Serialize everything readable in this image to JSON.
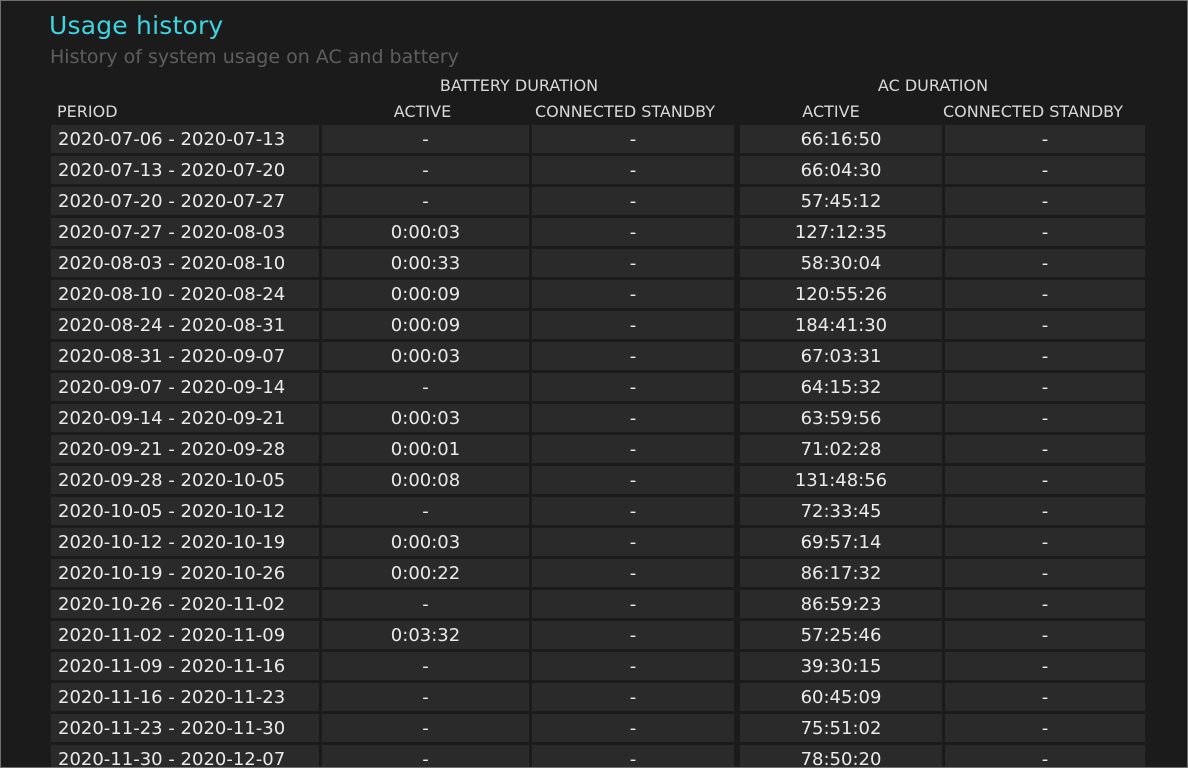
{
  "header": {
    "title": "Usage history",
    "subtitle": "History of system usage on AC and battery"
  },
  "table": {
    "group_headers": {
      "battery": "BATTERY DURATION",
      "ac": "AC DURATION"
    },
    "columns": {
      "period": "PERIOD",
      "battery_active": "ACTIVE",
      "battery_connected_standby": "CONNECTED STANDBY",
      "ac_active": "ACTIVE",
      "ac_connected_standby": "CONNECTED STANDBY"
    },
    "rows": [
      {
        "period": "2020-07-06 - 2020-07-13",
        "battery_active": "-",
        "battery_cs": "-",
        "ac_active": "66:16:50",
        "ac_cs": "-"
      },
      {
        "period": "2020-07-13 - 2020-07-20",
        "battery_active": "-",
        "battery_cs": "-",
        "ac_active": "66:04:30",
        "ac_cs": "-"
      },
      {
        "period": "2020-07-20 - 2020-07-27",
        "battery_active": "-",
        "battery_cs": "-",
        "ac_active": "57:45:12",
        "ac_cs": "-"
      },
      {
        "period": "2020-07-27 - 2020-08-03",
        "battery_active": "0:00:03",
        "battery_cs": "-",
        "ac_active": "127:12:35",
        "ac_cs": "-"
      },
      {
        "period": "2020-08-03 - 2020-08-10",
        "battery_active": "0:00:33",
        "battery_cs": "-",
        "ac_active": "58:30:04",
        "ac_cs": "-"
      },
      {
        "period": "2020-08-10 - 2020-08-24",
        "battery_active": "0:00:09",
        "battery_cs": "-",
        "ac_active": "120:55:26",
        "ac_cs": "-"
      },
      {
        "period": "2020-08-24 - 2020-08-31",
        "battery_active": "0:00:09",
        "battery_cs": "-",
        "ac_active": "184:41:30",
        "ac_cs": "-"
      },
      {
        "period": "2020-08-31 - 2020-09-07",
        "battery_active": "0:00:03",
        "battery_cs": "-",
        "ac_active": "67:03:31",
        "ac_cs": "-"
      },
      {
        "period": "2020-09-07 - 2020-09-14",
        "battery_active": "-",
        "battery_cs": "-",
        "ac_active": "64:15:32",
        "ac_cs": "-"
      },
      {
        "period": "2020-09-14 - 2020-09-21",
        "battery_active": "0:00:03",
        "battery_cs": "-",
        "ac_active": "63:59:56",
        "ac_cs": "-"
      },
      {
        "period": "2020-09-21 - 2020-09-28",
        "battery_active": "0:00:01",
        "battery_cs": "-",
        "ac_active": "71:02:28",
        "ac_cs": "-"
      },
      {
        "period": "2020-09-28 - 2020-10-05",
        "battery_active": "0:00:08",
        "battery_cs": "-",
        "ac_active": "131:48:56",
        "ac_cs": "-"
      },
      {
        "period": "2020-10-05 - 2020-10-12",
        "battery_active": "-",
        "battery_cs": "-",
        "ac_active": "72:33:45",
        "ac_cs": "-"
      },
      {
        "period": "2020-10-12 - 2020-10-19",
        "battery_active": "0:00:03",
        "battery_cs": "-",
        "ac_active": "69:57:14",
        "ac_cs": "-"
      },
      {
        "period": "2020-10-19 - 2020-10-26",
        "battery_active": "0:00:22",
        "battery_cs": "-",
        "ac_active": "86:17:32",
        "ac_cs": "-"
      },
      {
        "period": "2020-10-26 - 2020-11-02",
        "battery_active": "-",
        "battery_cs": "-",
        "ac_active": "86:59:23",
        "ac_cs": "-"
      },
      {
        "period": "2020-11-02 - 2020-11-09",
        "battery_active": "0:03:32",
        "battery_cs": "-",
        "ac_active": "57:25:46",
        "ac_cs": "-"
      },
      {
        "period": "2020-11-09 - 2020-11-16",
        "battery_active": "-",
        "battery_cs": "-",
        "ac_active": "39:30:15",
        "ac_cs": "-"
      },
      {
        "period": "2020-11-16 - 2020-11-23",
        "battery_active": "-",
        "battery_cs": "-",
        "ac_active": "60:45:09",
        "ac_cs": "-"
      },
      {
        "period": "2020-11-23 - 2020-11-30",
        "battery_active": "-",
        "battery_cs": "-",
        "ac_active": "75:51:02",
        "ac_cs": "-"
      },
      {
        "period": "2020-11-30 - 2020-12-07",
        "battery_active": "-",
        "battery_cs": "-",
        "ac_active": "78:50:20",
        "ac_cs": "-"
      }
    ]
  }
}
